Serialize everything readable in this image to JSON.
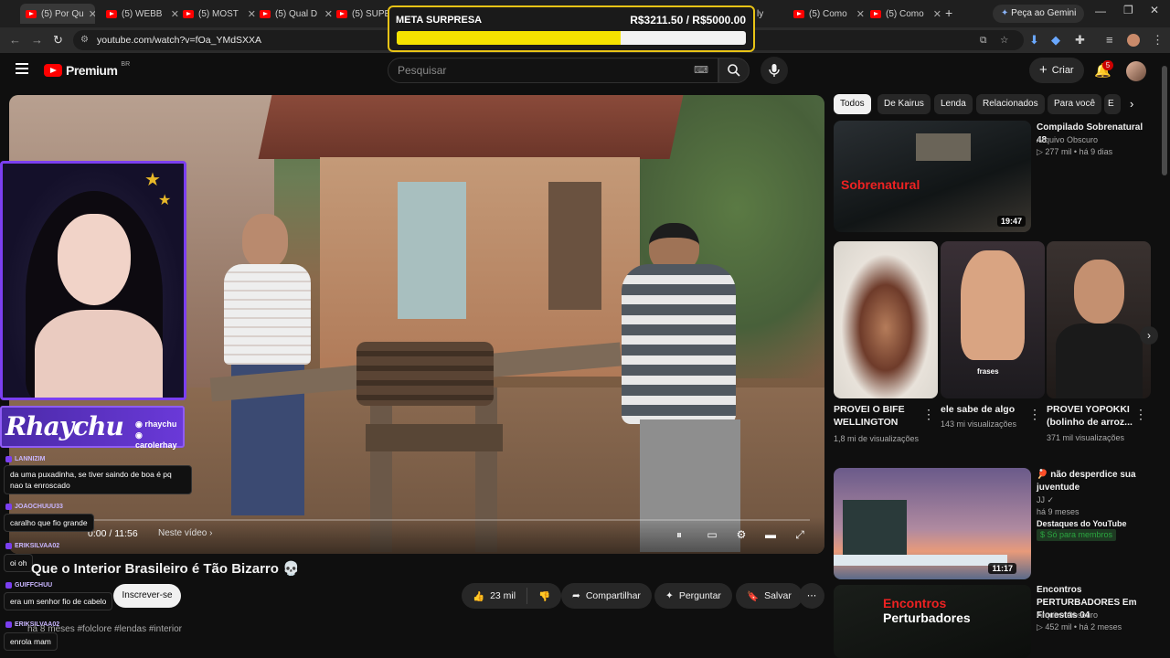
{
  "browser": {
    "tabs": [
      {
        "label": "(5) Por Qu",
        "active": true
      },
      {
        "label": "(5) WEBB"
      },
      {
        "label": "(5) MOST"
      },
      {
        "label": "(5) Qual D"
      },
      {
        "label": "(5) SUPER"
      },
      {
        "label": "ly"
      },
      {
        "label": "(5) Como"
      },
      {
        "label": "(5) Como"
      }
    ],
    "gemini_label": "Peça ao Gemini",
    "url": "youtube.com/watch?v=fOa_YMdSXXA"
  },
  "youtube": {
    "logo_text": "Premium",
    "logo_badge": "BR",
    "search_placeholder": "Pesquisar",
    "create_label": "Criar",
    "notifications_count": "5"
  },
  "goal": {
    "title": "META SURPRESA",
    "amount": "R$3211.50 / R$5000.00",
    "progress": 0.6423
  },
  "stream_overlay": {
    "brand_name": "Rhaychu",
    "handles": [
      "rhaychu",
      "carolerhay"
    ],
    "chat": [
      {
        "user": "LANNIZIM",
        "text": "da uma puxadinha, se tiver saindo de boa é pq nao ta enroscado"
      },
      {
        "user": "JOAOCHUUU33",
        "text": "caralho que fio grande"
      },
      {
        "user": "ERIKSILVAA02",
        "text": "oi oh"
      },
      {
        "user": "GUIFFCHUU",
        "text": "era um senhor fio de cabelo"
      },
      {
        "user": "ERIKSILVAA02",
        "text": "enrola mam"
      }
    ]
  },
  "player": {
    "time": "0:00 / 11:56",
    "next_label": "Neste vídeo"
  },
  "video": {
    "title": "Que o Interior Brasileiro é Tão Bizarro 💀",
    "subscribe_label": "Inscrever-se",
    "likes": "23 mil",
    "share_label": "Compartilhar",
    "ask_label": "Perguntar",
    "save_label": "Salvar",
    "meta": "há 8 meses  #folclore #lendas #interior"
  },
  "sidebar": {
    "chips": [
      "Todos",
      "De Kairus",
      "Lenda",
      "Relacionados",
      "Para você",
      "E"
    ],
    "items": [
      {
        "title": "Compilado Sobrenatural 48",
        "channel": "Arquivo Obscuro",
        "views": "▷ 277 mil • há 9 dias",
        "duration": "19:47",
        "thumb_text": "Sobrenatural"
      },
      {
        "title": "não desperdice sua juventude",
        "channel": "JJ",
        "date": "há 9 meses",
        "source": "Destaques do YouTube",
        "members": "Só para membros",
        "duration": "11:17"
      },
      {
        "title": "Encontros PERTURBADORES Em Florestas 04",
        "channel": "Arquivo Obscuro",
        "views": "▷ 452 mil • há 2 meses",
        "thumb_text_1": "Encontros",
        "thumb_text_2": "Perturbadores"
      }
    ],
    "shorts": [
      {
        "title": "PROVEI O BIFE WELLINGTON",
        "views": "1,8 mi de visualizações"
      },
      {
        "title": "ele sabe de algo",
        "views": "143 mi visualizações",
        "overlay": "frases"
      },
      {
        "title": "PROVEI YOPOKKI (bolinho de arroz...",
        "views": "371 mil visualizações"
      }
    ]
  }
}
